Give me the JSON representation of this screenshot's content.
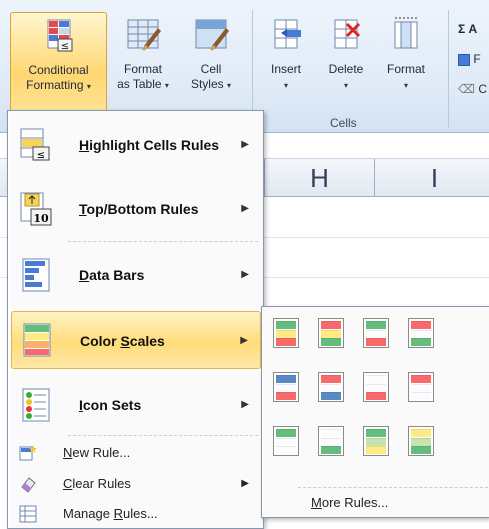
{
  "ribbon": {
    "buttons": [
      {
        "line1": "Conditional",
        "line2": "Formatting",
        "icon": "conditional-formatting-icon",
        "active": true
      },
      {
        "line1": "Format",
        "line2": "as Table",
        "icon": "format-as-table-icon"
      },
      {
        "line1": "Cell",
        "line2": "Styles",
        "icon": "cell-styles-icon"
      },
      {
        "line1": "Insert",
        "line2": "",
        "icon": "insert-cells-icon"
      },
      {
        "line1": "Delete",
        "line2": "",
        "icon": "delete-cells-icon"
      },
      {
        "line1": "Format",
        "line2": "",
        "icon": "format-cells-icon"
      }
    ],
    "cells_group_label": "Cells",
    "editing": [
      {
        "text": "Σ A",
        "icon": "autosum-icon"
      },
      {
        "text": "F",
        "icon": "fill-icon"
      },
      {
        "text": "C",
        "icon": "clear-icon"
      }
    ]
  },
  "sheet": {
    "columns": [
      "H",
      "I"
    ]
  },
  "menu": {
    "items": [
      {
        "label": "Highlight Cells Rules",
        "accel": "H",
        "icon": "highlight-cells-rules-icon",
        "has_sub": true
      },
      {
        "label": "Top/Bottom Rules",
        "accel": "T",
        "icon": "top-bottom-rules-icon",
        "has_sub": true
      },
      {
        "label": "Data Bars",
        "accel": "D",
        "icon": "data-bars-icon",
        "has_sub": true
      },
      {
        "label": "Color Scales",
        "accel": "S",
        "icon": "color-scales-icon",
        "has_sub": true,
        "highlighted": true
      },
      {
        "label": "Icon Sets",
        "accel": "I",
        "icon": "icon-sets-icon",
        "has_sub": true
      }
    ],
    "small_items": [
      {
        "label": "New Rule...",
        "accel": "N",
        "icon": "new-rule-icon"
      },
      {
        "label": "Clear Rules",
        "accel": "C",
        "icon": "clear-rules-icon",
        "has_sub": true
      },
      {
        "label": "Manage Rules...",
        "accel": "R",
        "icon": "manage-rules-icon"
      }
    ],
    "submenu_arrow": "▶"
  },
  "submenu": {
    "swatches": [
      [
        "#63be7b",
        "#ffeb84",
        "#f8696b"
      ],
      [
        "#f8696b",
        "#ffeb84",
        "#63be7b"
      ],
      [
        "#63be7b",
        "#fcfcff",
        "#f8696b"
      ],
      [
        "#f8696b",
        "#fcfcff",
        "#63be7b"
      ],
      [
        "#5a8ac6",
        "#fcfcff",
        "#f8696b"
      ],
      [
        "#f8696b",
        "#fcfcff",
        "#5a8ac6"
      ],
      [
        "#fcfcff",
        "#fcfcff",
        "#f8696b"
      ],
      [
        "#f8696b",
        "#fcfcff",
        "#fcfcff"
      ],
      [
        "#63be7b",
        "#fcfcff",
        "#fcfcff"
      ],
      [
        "#fcfcff",
        "#fcfcff",
        "#63be7b"
      ],
      [
        "#63be7b",
        "#c6e4b0",
        "#ffeb84"
      ],
      [
        "#ffeb84",
        "#c6e4b0",
        "#63be7b"
      ]
    ],
    "more_rules": "More Rules...",
    "more_accel": "M"
  }
}
